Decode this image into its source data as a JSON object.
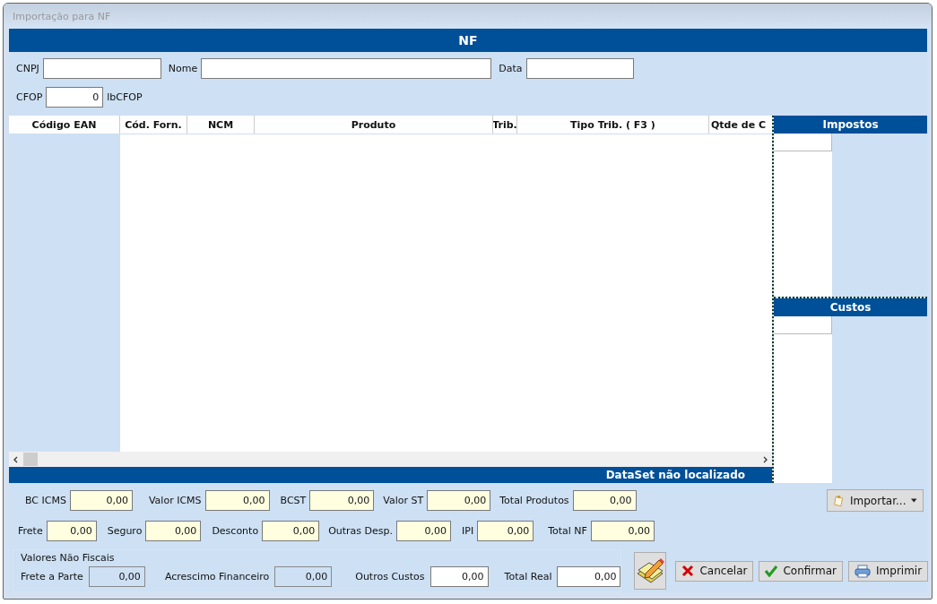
{
  "window": {
    "title": "Importação para NF"
  },
  "header": {
    "title": "NF"
  },
  "fields": [
    {
      "label": "CNPJ"
    },
    {
      "label": "Nome"
    },
    {
      "label": "Data"
    }
  ],
  "cfop": {
    "label": "CFOP",
    "value": "0",
    "caption": "lbCFOP"
  },
  "grid": {
    "columns": [
      "Código EAN",
      "Cód. Forn.",
      "NCM",
      "Produto",
      "Trib.",
      "Tipo Trib. ( F3 )",
      "Qtde de C"
    ],
    "footer": "DataSet não localizado"
  },
  "side_panels": [
    {
      "title": "Impostos"
    },
    {
      "title": "Custos"
    }
  ],
  "totals_row_1": [
    {
      "label": "BC ICMS",
      "value": "0,00"
    },
    {
      "label": "Valor ICMS",
      "value": "0,00"
    },
    {
      "label": "BCST",
      "value": "0,00"
    },
    {
      "label": "Valor ST",
      "value": "0,00"
    },
    {
      "label": "Total Produtos",
      "value": "0,00"
    }
  ],
  "totals_row_2": [
    {
      "label": "Frete",
      "value": "0,00"
    },
    {
      "label": "Seguro",
      "value": "0,00"
    },
    {
      "label": "Desconto",
      "value": "0,00"
    },
    {
      "label": "Outras Desp.",
      "value": "0,00"
    },
    {
      "label": "IPI",
      "value": "0,00"
    },
    {
      "label": "Total NF",
      "value": "0,00"
    }
  ],
  "non_fiscal": {
    "title": "Valores Não Fiscais",
    "fields": [
      {
        "label": "Frete a Parte",
        "value": "0,00",
        "disabled": true
      },
      {
        "label": "Acrescimo Financeiro",
        "value": "0,00",
        "disabled": true
      },
      {
        "label": "Outros Custos",
        "value": "0,00",
        "disabled": false
      },
      {
        "label": "Total Real",
        "value": "0,00",
        "disabled": false
      }
    ]
  },
  "import_button": {
    "label": "Importar..."
  },
  "actions": [
    {
      "kind": "edit"
    },
    {
      "kind": "cancel",
      "label": "Cancelar"
    },
    {
      "kind": "confirm",
      "label": "Confirmar"
    },
    {
      "kind": "print",
      "label": "Imprimir"
    }
  ]
}
